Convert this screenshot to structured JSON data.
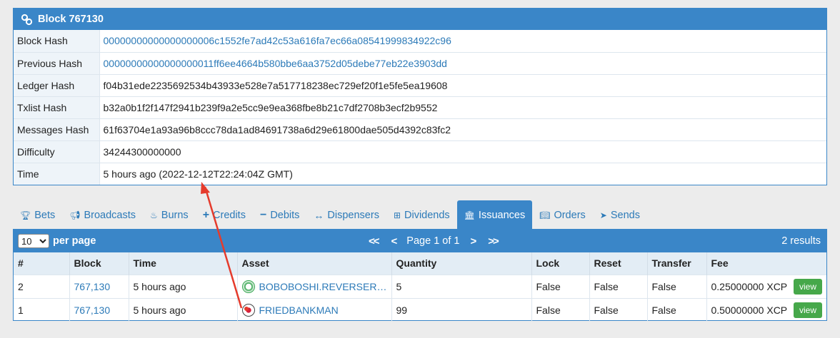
{
  "block": {
    "title": "Block 767130",
    "rows": [
      {
        "key": "Block Hash",
        "value": "00000000000000000006c1552fe7ad42c53a616fa7ec66a08541999834922c96",
        "link": true
      },
      {
        "key": "Previous Hash",
        "value": "00000000000000000011ff6ee4664b580bbe6aa3752d05debe77eb22e3903dd",
        "link": true
      },
      {
        "key": "Ledger Hash",
        "value": "f04b31ede2235692534b43933e528e7a517718238ec729ef20f1e5fe5ea19608",
        "link": false
      },
      {
        "key": "Txlist Hash",
        "value": "b32a0b1f2f147f2941b239f9a2e5cc9e9ea368fbe8b21c7df2708b3ecf2b9552",
        "link": false
      },
      {
        "key": "Messages Hash",
        "value": "61f63704e1a93a96b8ccc78da1ad84691738a6d29e61800dae505d4392c83fc2",
        "link": false
      },
      {
        "key": "Difficulty",
        "value": "34244300000000",
        "link": false
      },
      {
        "key": "Time",
        "value": "5 hours ago (2022-12-12T22:24:04Z GMT)",
        "link": false
      }
    ]
  },
  "tabs": [
    {
      "label": "Bets",
      "icon": "trophy-icon",
      "active": false
    },
    {
      "label": "Broadcasts",
      "icon": "bullhorn-icon",
      "active": false
    },
    {
      "label": "Burns",
      "icon": "fire-icon",
      "active": false
    },
    {
      "label": "Credits",
      "icon": "plus-icon",
      "active": false
    },
    {
      "label": "Debits",
      "icon": "minus-icon",
      "active": false
    },
    {
      "label": "Dispensers",
      "icon": "arrows-h-icon",
      "active": false
    },
    {
      "label": "Dividends",
      "icon": "sitemap-icon",
      "active": false
    },
    {
      "label": "Issuances",
      "icon": "bank-icon",
      "active": true
    },
    {
      "label": "Orders",
      "icon": "book-icon",
      "active": false
    },
    {
      "label": "Sends",
      "icon": "paper-plane-icon",
      "active": false
    }
  ],
  "issuances": {
    "per_page_value": "10",
    "per_page_label": "per page",
    "first": "<<",
    "prev": "<",
    "page_text": "Page 1 of 1",
    "next": ">",
    "last": ">>",
    "results": "2 results",
    "columns": [
      "#",
      "Block",
      "Time",
      "Asset",
      "Quantity",
      "Lock",
      "Reset",
      "Transfer",
      "Fee"
    ],
    "rows": [
      {
        "num": "2",
        "block": "767,130",
        "time": "5 hours ago",
        "asset": "BOBOBOSHI.REVERSERAINB",
        "quantity": "5",
        "lock": "False",
        "reset": "False",
        "transfer": "False",
        "fee": "0.25000000 XCP",
        "action": "view"
      },
      {
        "num": "1",
        "block": "767,130",
        "time": "5 hours ago",
        "asset": "FRIEDBANKMAN",
        "quantity": "99",
        "lock": "False",
        "reset": "False",
        "transfer": "False",
        "fee": "0.50000000 XCP",
        "action": "view"
      }
    ]
  },
  "colors": {
    "accent": "#3a86c8",
    "link": "#2c7ab8",
    "view_button": "#46a84a",
    "arrow": "#e53b2c"
  }
}
